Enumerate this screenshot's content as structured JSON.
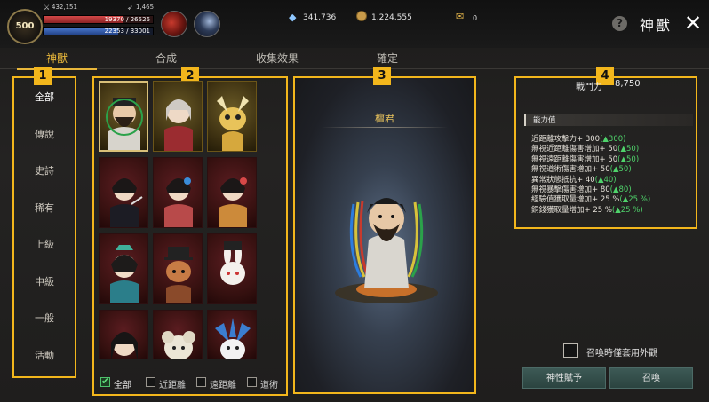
{
  "player": {
    "level": "500",
    "power": "432,151",
    "arrow_count": "1,465",
    "hp": "19370 / 26526",
    "hp_fraction": 0.73,
    "mp": "22353 / 33001",
    "mp_fraction": 0.68
  },
  "currency": {
    "diamond": "341,736",
    "coin": "1,224,555",
    "ticket": "0"
  },
  "header": {
    "title": "神獸"
  },
  "tabs": [
    {
      "label": "神獸",
      "active": true
    },
    {
      "label": "合成",
      "active": false
    },
    {
      "label": "收集效果",
      "active": false
    },
    {
      "label": "確定",
      "active": false
    }
  ],
  "annotations": [
    "1",
    "2",
    "3",
    "4"
  ],
  "categories": [
    {
      "label": "全部",
      "active": true
    },
    {
      "label": "傳說",
      "active": false
    },
    {
      "label": "史詩",
      "active": false
    },
    {
      "label": "稀有",
      "active": false
    },
    {
      "label": "上級",
      "active": false
    },
    {
      "label": "中級",
      "active": false
    },
    {
      "label": "一般",
      "active": false
    },
    {
      "label": "活動",
      "active": false
    }
  ],
  "filters": [
    {
      "label": "全部",
      "checked": true
    },
    {
      "label": "近距離",
      "checked": false
    },
    {
      "label": "遠距離",
      "checked": false
    },
    {
      "label": "道術",
      "checked": false
    }
  ],
  "selected_beast": {
    "name": "檀君"
  },
  "stats": {
    "power_label": "戰鬥力",
    "power_value": "8,750",
    "section_title": "能力值",
    "lines": [
      {
        "text": "近距離攻擊力+ 300",
        "bonus": "(▲300)"
      },
      {
        "text": "無視近距離傷害增加+ 50",
        "bonus": "(▲50)"
      },
      {
        "text": "無視遠距離傷害增加+ 50",
        "bonus": "(▲50)"
      },
      {
        "text": "無視道術傷害增加+ 50",
        "bonus": "(▲50)"
      },
      {
        "text": "異常狀態抵抗+ 40",
        "bonus": "(▲40)"
      },
      {
        "text": "無視暴擊傷害增加+ 80",
        "bonus": "(▲80)"
      },
      {
        "text": "經驗值獲取量增加+ 25 %",
        "bonus": "(▲25 %)"
      },
      {
        "text": "銅錢獲取量增加+ 25 %",
        "bonus": "(▲25 %)"
      }
    ]
  },
  "appearance_option": {
    "label": "召喚時僅套用外觀",
    "checked": false
  },
  "buttons": {
    "grant": "神性賦予",
    "summon": "召喚"
  },
  "colors": {
    "accent": "#e9b73b",
    "annotation": "#f2b61c",
    "bonus": "#4fd36b",
    "hp": "#c0383a",
    "mp": "#3d68b8"
  },
  "icons": [
    "level-badge-icon",
    "sword-icon",
    "arrow-icon",
    "skill-icon",
    "diamond-icon",
    "coin-icon",
    "ticket-icon",
    "help-icon",
    "close-icon",
    "checkbox-icon"
  ]
}
